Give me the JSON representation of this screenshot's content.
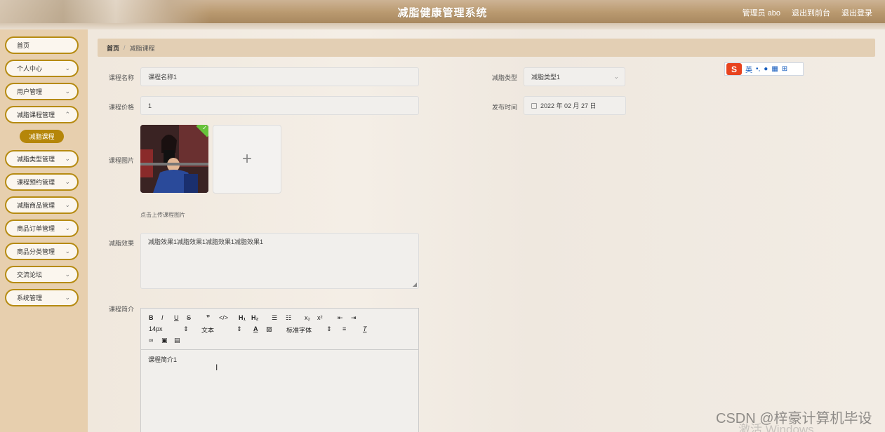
{
  "header": {
    "title": "减脂健康管理系统",
    "links": [
      "管理员 abo",
      "退出到前台",
      "退出登录"
    ]
  },
  "sidebar": {
    "items": [
      {
        "label": "首页",
        "has_arrow": false
      },
      {
        "label": "个人中心",
        "has_arrow": true
      },
      {
        "label": "用户管理",
        "has_arrow": true
      },
      {
        "label": "减脂课程管理",
        "has_arrow": true
      },
      {
        "label": "减脂类型管理",
        "has_arrow": true
      },
      {
        "label": "课程预约管理",
        "has_arrow": true
      },
      {
        "label": "减脂商品管理",
        "has_arrow": true
      },
      {
        "label": "商品订单管理",
        "has_arrow": true
      },
      {
        "label": "商品分类管理",
        "has_arrow": true
      },
      {
        "label": "交流论坛",
        "has_arrow": true
      },
      {
        "label": "系统管理",
        "has_arrow": true
      }
    ],
    "active_sub": "减脂课程",
    "accent_color": "#b5860a"
  },
  "breadcrumb": {
    "home": "首页",
    "separator": "/",
    "current": "减脂课程"
  },
  "form": {
    "course_name": {
      "label": "课程名称",
      "value": "课程名称1"
    },
    "fat_type": {
      "label": "减脂类型",
      "value": "减脂类型1"
    },
    "course_price": {
      "label": "课程价格",
      "value": "1"
    },
    "publish_time": {
      "label": "发布时间",
      "value": "2022 年 02 月 27 日"
    },
    "course_image": {
      "label": "课程图片",
      "hint": "点击上传课程图片",
      "add_icon": "+"
    },
    "fat_effect": {
      "label": "减脂效果",
      "value": "减脂效果1减脂效果1减脂效果1减脂效果1"
    },
    "course_intro": {
      "label": "课程简介",
      "content": "课程简介1",
      "toolbar": {
        "row1": [
          "B",
          "I",
          "U",
          "S",
          "❞",
          "</>",
          "H₁",
          "H₂",
          "☰",
          "☷",
          "x₂",
          "x²",
          "⇤",
          "⇥"
        ],
        "font_size": "14px",
        "block_type": "文本",
        "font_family": "标准字体"
      }
    }
  },
  "ime": {
    "mode": "英",
    "logo": "S"
  },
  "overlay": {
    "watermark": "CSDN @梓豪计算机毕设",
    "windows_activation": "激活 Windows"
  }
}
